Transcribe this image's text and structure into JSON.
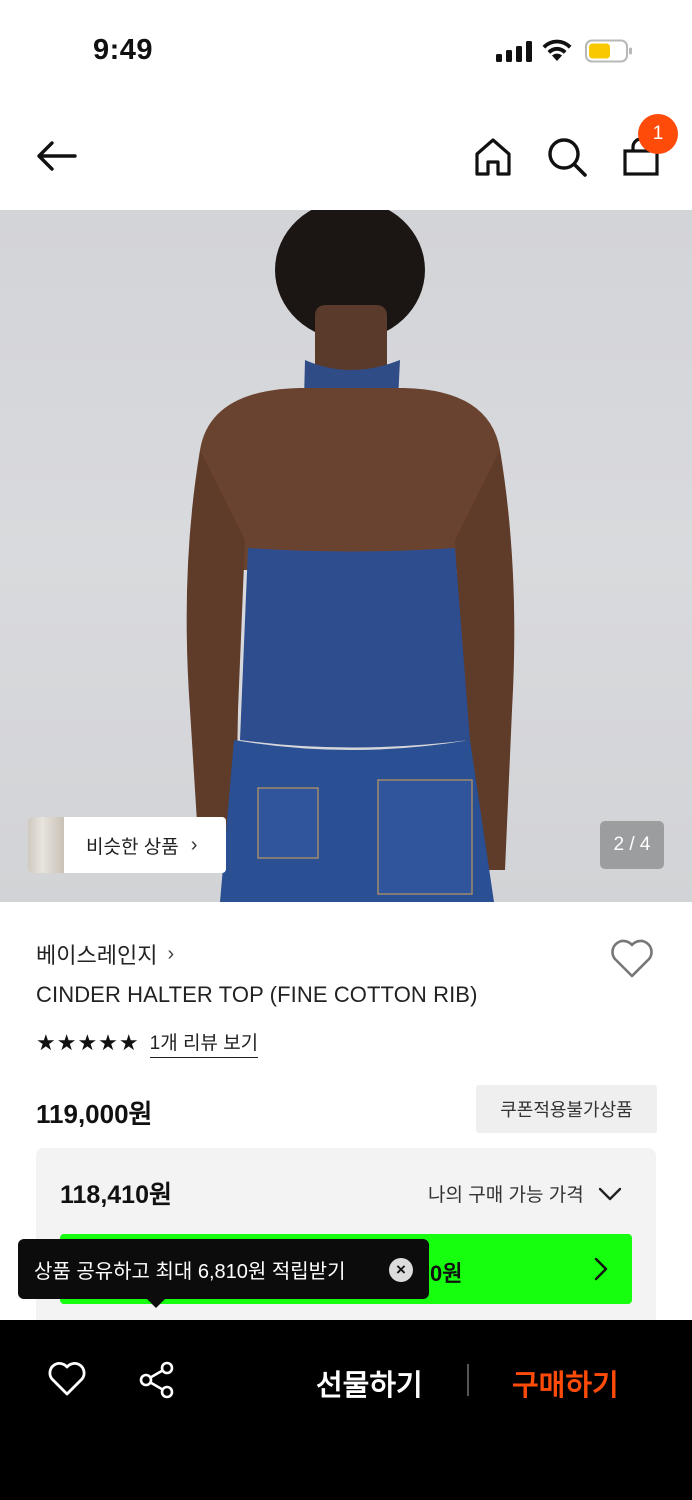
{
  "status_bar": {
    "time": "9:49"
  },
  "header": {
    "cart_count": "1"
  },
  "hero": {
    "similar_label": "비슷한 상품",
    "page_indicator": "2 / 4"
  },
  "product": {
    "brand": "베이스레인지",
    "name": "CINDER HALTER TOP (FINE COTTON RIB)",
    "stars": "★★★★★",
    "review_link": "1개 리뷰 보기",
    "price": "119,000원",
    "coupon_badge": "쿠폰적용불가상품"
  },
  "price_card": {
    "my_price": "118,410원",
    "my_price_label": "나의 구매 가능 가격",
    "button_text_visible": "0원"
  },
  "tooltip": {
    "text": "상품 공유하고 최대 6,810원 적립받기",
    "close_glyph": "×"
  },
  "bottom_bar": {
    "gift_label": "선물하기",
    "buy_label": "구매하기"
  },
  "colors": {
    "accent": "#ff4b0a",
    "green": "#16ff0e",
    "bar": "#000000"
  }
}
